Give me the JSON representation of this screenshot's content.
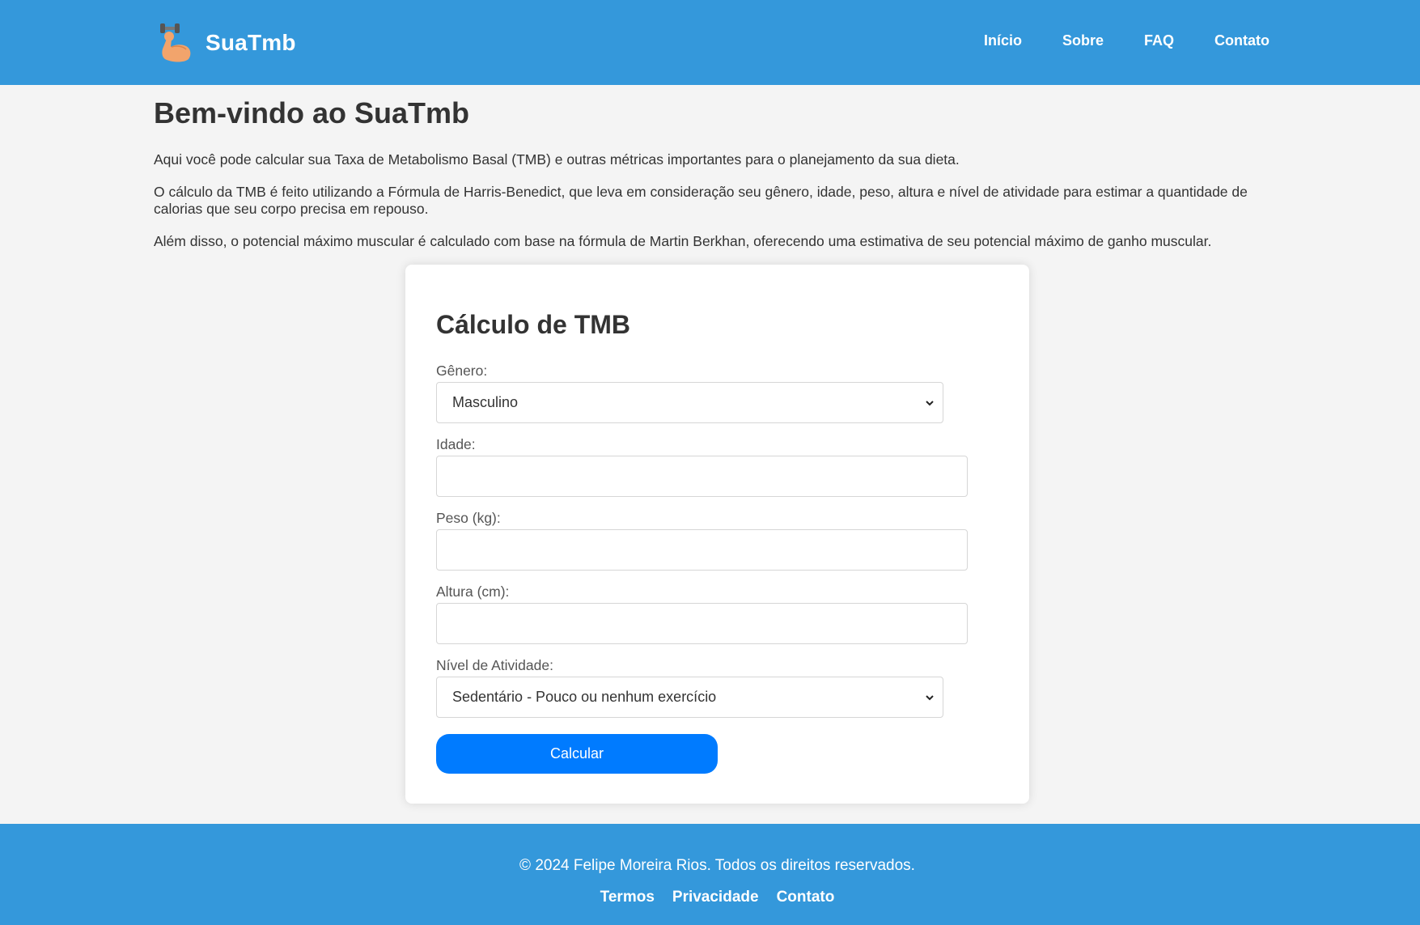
{
  "header": {
    "brand_name": "SuaTmb",
    "logo_icon": "flexed-biceps-dumbbell-icon",
    "nav": [
      {
        "label": "Início"
      },
      {
        "label": "Sobre"
      },
      {
        "label": "FAQ"
      },
      {
        "label": "Contato"
      }
    ]
  },
  "main": {
    "title": "Bem-vindo ao SuaTmb",
    "paragraphs": [
      "Aqui você pode calcular sua Taxa de Metabolismo Basal (TMB) e outras métricas importantes para o planejamento da sua dieta.",
      "O cálculo da TMB é feito utilizando a Fórmula de Harris-Benedict, que leva em consideração seu gênero, idade, peso, altura e nível de atividade para estimar a quantidade de calorias que seu corpo precisa em repouso.",
      "Além disso, o potencial máximo muscular é calculado com base na fórmula de Martin Berkhan, oferecendo uma estimativa de seu potencial máximo de ganho muscular."
    ]
  },
  "form": {
    "title": "Cálculo de TMB",
    "gender": {
      "label": "Gênero:",
      "value": "Masculino"
    },
    "age": {
      "label": "Idade:",
      "value": ""
    },
    "weight": {
      "label": "Peso (kg):",
      "value": ""
    },
    "height": {
      "label": "Altura (cm):",
      "value": ""
    },
    "activity": {
      "label": "Nível de Atividade:",
      "value": "Sedentário - Pouco ou nenhum exercício"
    },
    "submit_label": "Calcular"
  },
  "footer": {
    "copyright": "© 2024 Felipe Moreira Rios. Todos os direitos reservados.",
    "links": [
      {
        "label": "Termos"
      },
      {
        "label": "Privacidade"
      },
      {
        "label": "Contato"
      }
    ]
  },
  "colors": {
    "header_bg": "#3498db",
    "page_bg": "#f4f4f4",
    "button_bg": "#007bff",
    "text": "#333333"
  }
}
